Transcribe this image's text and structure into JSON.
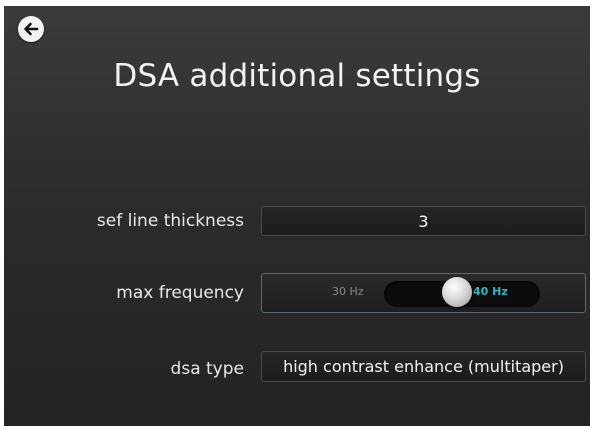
{
  "header": {
    "title": "DSA additional settings",
    "back_icon": "arrow-left-circle-icon"
  },
  "settings": {
    "sef_line_thickness": {
      "label": "sef line thickness",
      "value": "3"
    },
    "max_frequency": {
      "label": "max frequency",
      "off_label": "30 Hz",
      "on_label": "40 Hz",
      "selected": "40 Hz",
      "position": 0.4
    },
    "dsa_type": {
      "label": "dsa type",
      "value": "high contrast enhance (multitaper)"
    }
  },
  "colors": {
    "accent": "#2bb7c9",
    "background": "#2c2c2c",
    "text": "#f2f2f2"
  }
}
